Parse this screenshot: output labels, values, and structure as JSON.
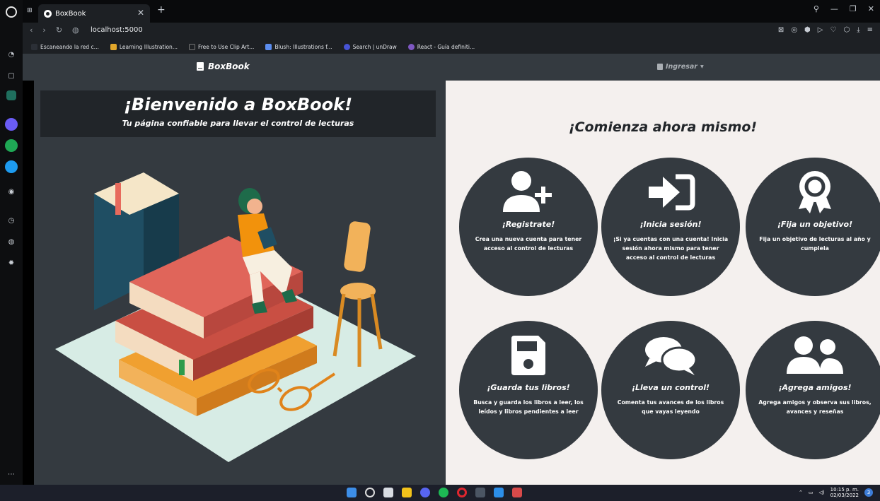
{
  "browser": {
    "mini_tab": "⊞",
    "tab_title": "BoxBook",
    "url": "localhost:5000",
    "bookmarks": [
      {
        "label": "Escaneando la red c...",
        "color": "#2b2f36"
      },
      {
        "label": "Learning Illustration...",
        "color": "#e2a72b"
      },
      {
        "label": "Free to Use Clip Art...",
        "color": "#1d2024"
      },
      {
        "label": "Blush: Illustrations f...",
        "color": "#5b8def"
      },
      {
        "label": "Search | unDraw",
        "color": "#4754d6"
      },
      {
        "label": "React - Guía definiti...",
        "color": "#7e57c2"
      }
    ]
  },
  "app": {
    "brand": "BoxBook",
    "login": "Ingresar",
    "welcome_title": "¡Bienvenido a BoxBook!",
    "welcome_subtitle": "Tu página confiable para llevar el control de lecturas",
    "cta": "¡Comienza ahora mismo!",
    "features": [
      {
        "icon": "user-plus-icon",
        "title": "¡Registrate!",
        "text": "Crea una nueva cuenta para tener acceso al control de lecturas"
      },
      {
        "icon": "sign-in-icon",
        "title": "¡Inicia sesión!",
        "text": "¡Si ya cuentas con una cuenta! Inicia sesión ahora mismo para tener acceso al control de lecturas"
      },
      {
        "icon": "award-icon",
        "title": "¡Fija un objetivo!",
        "text": "Fija un objetivo de lecturas al año y cumplela"
      },
      {
        "icon": "save-icon",
        "title": "¡Guarda tus libros!",
        "text": "Busca y guarda los libros a leer, los leídos y libros pendientes a leer"
      },
      {
        "icon": "comments-icon",
        "title": "¡Lleva un control!",
        "text": "Comenta tus avances de los libros que vayas leyendo"
      },
      {
        "icon": "user-friends-icon",
        "title": "¡Agrega amigos!",
        "text": "Agrega amigos y observa sus libros, avances y reseñas"
      }
    ]
  },
  "taskbar": {
    "time": "10:15 p. m.",
    "date": "02/03/2022",
    "notifications": "3"
  },
  "colors": {
    "panel_dark": "#343a40",
    "panel_light": "#f4f0ee",
    "header_dark": "#212529"
  }
}
